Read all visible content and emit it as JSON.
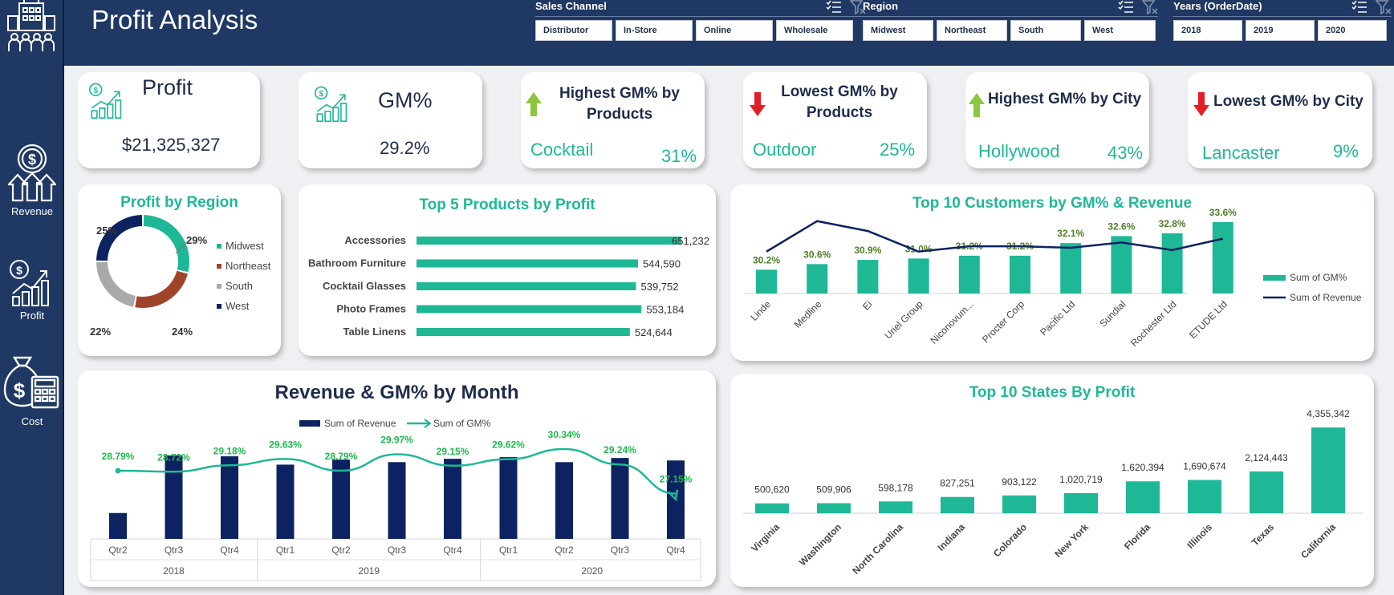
{
  "app": {
    "title": "Profit Analysis"
  },
  "nav": [
    {
      "label": "Revenue",
      "icon": "revenue-coin-arrows-icon"
    },
    {
      "label": "Profit",
      "icon": "profit-chart-icon"
    },
    {
      "label": "Cost",
      "icon": "cost-moneybag-calculator-icon"
    }
  ],
  "slicers": {
    "channel": {
      "title": "Sales Channel",
      "items": [
        "Distributor",
        "In-Store",
        "Online",
        "Wholesale"
      ]
    },
    "region": {
      "title": "Region",
      "items": [
        "Midwest",
        "Northeast",
        "South",
        "West"
      ]
    },
    "years": {
      "title": "Years (OrderDate)",
      "items": [
        "2018",
        "2019",
        "2020"
      ]
    }
  },
  "kpis": {
    "profit": {
      "title": "Profit",
      "value": "$21,325,327"
    },
    "gm": {
      "title": "GM%",
      "value": "29.2%"
    },
    "highest_product": {
      "title": "Highest GM% by Products",
      "name": "Cocktail",
      "value": "31%"
    },
    "lowest_product": {
      "title": "Lowest GM% by Products",
      "name": "Outdoor",
      "value": "25%"
    },
    "highest_city": {
      "title": "Highest GM% by City",
      "name": "Hollywood",
      "value": "43%"
    },
    "lowest_city": {
      "title": "Lowest GM% by City",
      "name": "Lancaster",
      "value": "9%"
    }
  },
  "colors": {
    "navy": "#1f3864",
    "teal": "#1fb896",
    "dark_navy": "#0d2260",
    "brown": "#a0432b",
    "gray": "#a9a9a9",
    "up": "#8dc63f",
    "down": "#e31e24"
  },
  "chart_data": [
    {
      "id": "region",
      "type": "pie",
      "title": "Profit by Region",
      "categories": [
        "Midwest",
        "Northeast",
        "South",
        "West"
      ],
      "values": [
        29,
        24,
        22,
        25
      ],
      "labels": [
        "29%",
        "24%",
        "22%",
        "25%"
      ],
      "legend": "right"
    },
    {
      "id": "products",
      "type": "bar",
      "title": "Top 5 Products by Profit",
      "categories": [
        "Accessories",
        "Bathroom Furniture",
        "Cocktail Glasses",
        "Photo Frames",
        "Table Linens"
      ],
      "values": [
        651232,
        544590,
        539752,
        553184,
        524644
      ],
      "labels": [
        "651,232",
        "544,590",
        "539,752",
        "553,184",
        "524,644"
      ],
      "xlim": [
        0,
        651232
      ]
    },
    {
      "id": "customers",
      "type": "bar",
      "title": "Top 10 Customers by GM% & Revenue",
      "categories": [
        "Linde",
        "Medline",
        "Ei",
        "Uriel Group",
        "Niconovum...",
        "Procter Corp",
        "Pacific Ltd",
        "Sundial",
        "Rochester Ltd",
        "ETUDE Ltd"
      ],
      "series": [
        {
          "name": "Sum of GM%",
          "values": [
            30.2,
            30.6,
            30.9,
            31.0,
            31.2,
            31.2,
            32.1,
            32.6,
            32.8,
            33.6
          ],
          "labels": [
            "30.2%",
            "30.6%",
            "30.9%",
            "31.0%",
            "31.2%",
            "31.2%",
            "32.1%",
            "32.6%",
            "32.8%",
            "33.6%"
          ]
        },
        {
          "name": "Sum of Revenue",
          "values": [
            0.55,
            0.95,
            0.82,
            0.55,
            0.62,
            0.62,
            0.6,
            0.67,
            0.57,
            0.72
          ]
        }
      ],
      "ylim": [
        28.5,
        34
      ],
      "legend": "right"
    },
    {
      "id": "monthly",
      "type": "bar",
      "title": "Revenue & GM% by Month",
      "categories": [
        "Qtr2",
        "Qtr3",
        "Qtr4",
        "Qtr1",
        "Qtr2",
        "Qtr3",
        "Qtr4",
        "Qtr1",
        "Qtr2",
        "Qtr3",
        "Qtr4"
      ],
      "groups": [
        {
          "label": "2018",
          "span": 3
        },
        {
          "label": "2019",
          "span": 4
        },
        {
          "label": "2020",
          "span": 4
        }
      ],
      "series": [
        {
          "name": "Sum of Revenue",
          "values": [
            0.31,
            1.0,
            0.99,
            0.89,
            0.95,
            0.92,
            0.96,
            0.98,
            0.92,
            0.97,
            0.94
          ]
        },
        {
          "name": "Sum of GM%",
          "values": [
            28.79,
            28.72,
            29.18,
            29.63,
            28.79,
            29.97,
            29.15,
            29.62,
            30.34,
            29.24,
            27.15
          ],
          "labels": [
            "28.79%",
            "28.72%",
            "29.18%",
            "29.63%",
            "28.79%",
            "29.97%",
            "29.15%",
            "29.62%",
            "30.34%",
            "29.24%",
            "27.15%"
          ]
        }
      ],
      "legend": "top"
    },
    {
      "id": "states",
      "type": "bar",
      "title": "Top 10 States By Profit",
      "categories": [
        "Virginia",
        "Washington",
        "North Carolina",
        "Indiana",
        "Colorado",
        "New York",
        "Florida",
        "Illinois",
        "Texas",
        "California"
      ],
      "values": [
        500620,
        509906,
        598178,
        827251,
        903122,
        1020719,
        1620394,
        1690674,
        2124443,
        4355342
      ],
      "labels": [
        "500,620",
        "509,906",
        "598,178",
        "827,251",
        "903,122",
        "1,020,719",
        "1,620,394",
        "1,690,674",
        "2,124,443",
        "4,355,342"
      ],
      "ylim": [
        0,
        4400000
      ]
    }
  ]
}
